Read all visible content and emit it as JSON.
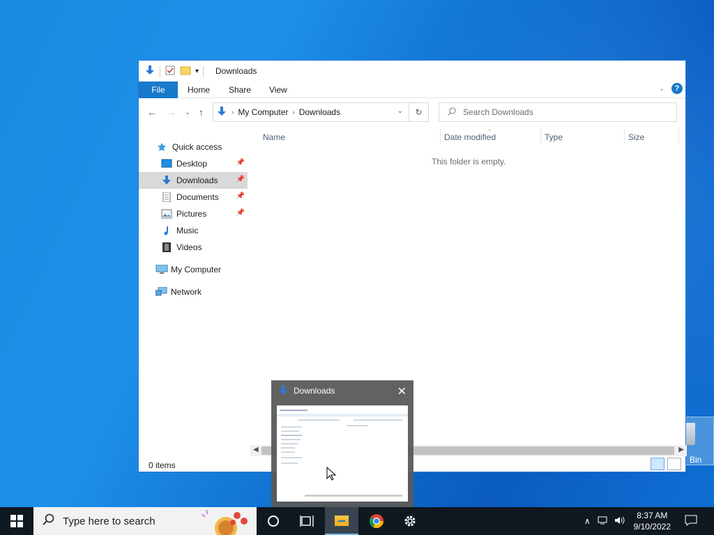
{
  "window": {
    "title": "Downloads",
    "tabs": {
      "file": "File",
      "home": "Home",
      "share": "Share",
      "view": "View"
    },
    "help": "?"
  },
  "address": {
    "crumbs": [
      "My Computer",
      "Downloads"
    ],
    "search_placeholder": "Search Downloads"
  },
  "nav_pane": {
    "quick_access": "Quick access",
    "items": [
      {
        "label": "Desktop",
        "pinned": true
      },
      {
        "label": "Downloads",
        "pinned": true,
        "selected": true
      },
      {
        "label": "Documents",
        "pinned": true
      },
      {
        "label": "Pictures",
        "pinned": true
      },
      {
        "label": "Music",
        "pinned": false
      },
      {
        "label": "Videos",
        "pinned": false
      }
    ],
    "my_computer": "My Computer",
    "network": "Network"
  },
  "columns": [
    "Name",
    "Date modified",
    "Type",
    "Size"
  ],
  "empty_message": "This folder is empty.",
  "status": {
    "items": "0 items"
  },
  "preview": {
    "title": "Downloads"
  },
  "desktop": {
    "recycle_bin_label": "Bin"
  },
  "taskbar": {
    "search_placeholder": "Type here to search",
    "time": "8:37 AM",
    "date": "9/10/2022"
  },
  "colors": {
    "accent": "#1979ca",
    "taskbar": "#101820",
    "desktop": "#1a8ae0"
  }
}
